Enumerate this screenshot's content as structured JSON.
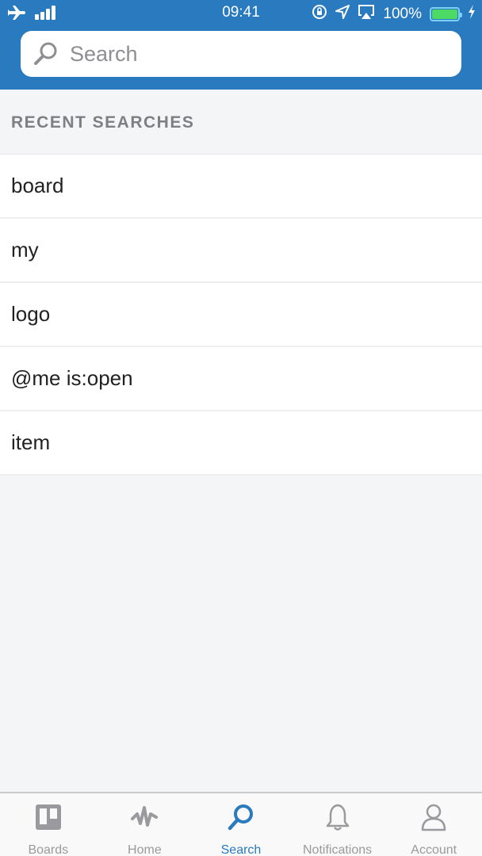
{
  "status_bar": {
    "time": "09:41",
    "battery_percent": "100%",
    "icons": [
      "airplane-icon",
      "signal-icon",
      "rotation-lock-icon",
      "location-icon",
      "airplay-icon",
      "battery-icon",
      "charging-icon"
    ]
  },
  "search": {
    "placeholder": "Search",
    "value": ""
  },
  "recent": {
    "header": "RECENT SEARCHES",
    "items": [
      "board",
      "my",
      "logo",
      "@me is:open",
      "item"
    ]
  },
  "tabbar": {
    "active": "Search",
    "accent_color": "#2a7ac0",
    "tabs": [
      {
        "label": "Boards",
        "icon": "boards-icon"
      },
      {
        "label": "Home",
        "icon": "activity-icon"
      },
      {
        "label": "Search",
        "icon": "search-icon"
      },
      {
        "label": "Notifications",
        "icon": "bell-icon"
      },
      {
        "label": "Account",
        "icon": "person-icon"
      }
    ]
  }
}
